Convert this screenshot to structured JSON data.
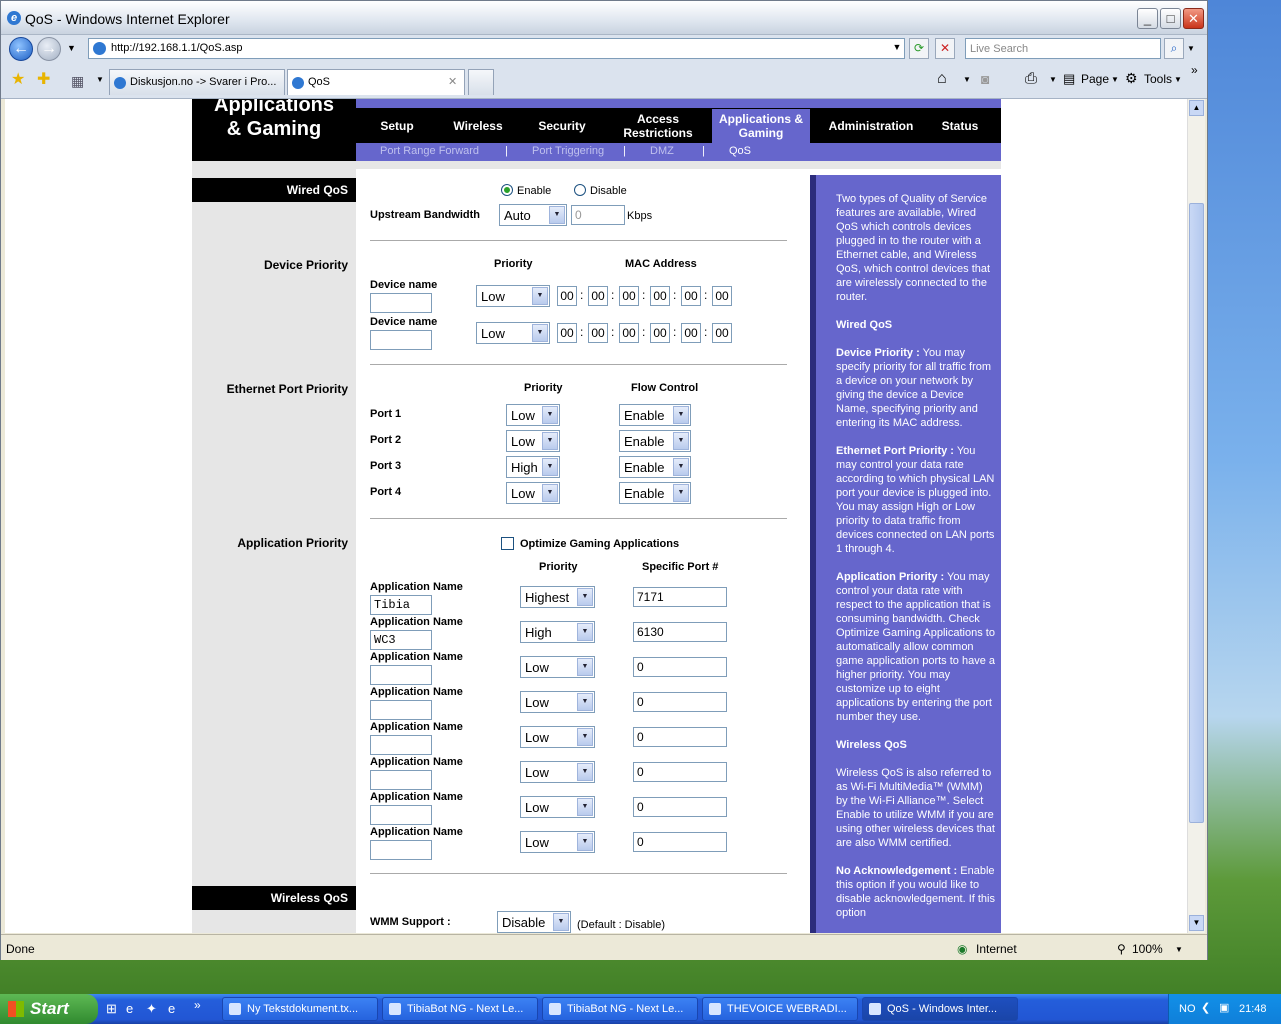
{
  "window": {
    "title": "QoS - Windows Internet Explorer"
  },
  "browser": {
    "address": "http://192.168.1.1/QoS.asp",
    "search_placeholder": "Live Search",
    "tabs": [
      {
        "label": "Diskusjon.no -> Svarer i Pro..."
      },
      {
        "label": "QoS"
      }
    ],
    "toolbar": {
      "page": "Page",
      "tools": "Tools"
    }
  },
  "status": {
    "text": "Done",
    "zone": "Internet",
    "zoom": "100%"
  },
  "router": {
    "header": "Applications & Gaming",
    "menu": [
      {
        "label": "Setup"
      },
      {
        "label": "Wireless"
      },
      {
        "label": "Security"
      },
      {
        "label": "Access Restrictions"
      },
      {
        "label": "Applications & Gaming"
      },
      {
        "label": "Administration"
      },
      {
        "label": "Status"
      }
    ],
    "submenu": [
      {
        "label": "Port Range Forward"
      },
      {
        "label": "Port Triggering"
      },
      {
        "label": "DMZ"
      },
      {
        "label": "QoS"
      }
    ],
    "sep": "|",
    "wired": {
      "section": "Wired QoS",
      "enable": "Enable",
      "disable": "Disable",
      "bandwidth_label": "Upstream Bandwidth",
      "bandwidth_value": "Auto",
      "bandwidth_num": "0",
      "unit": "Kbps"
    },
    "device": {
      "section": "Device Priority",
      "col_priority": "Priority",
      "col_mac": "MAC Address",
      "rows": [
        {
          "label": "Device name",
          "priority": "Low",
          "mac": [
            "00",
            "00",
            "00",
            "00",
            "00",
            "00"
          ]
        },
        {
          "label": "Device name",
          "priority": "Low",
          "mac": [
            "00",
            "00",
            "00",
            "00",
            "00",
            "00"
          ]
        }
      ],
      "colon": ":"
    },
    "ethernet": {
      "section": "Ethernet Port Priority",
      "col_priority": "Priority",
      "col_flow": "Flow Control",
      "rows": [
        {
          "port": "Port 1",
          "priority": "Low",
          "flow": "Enable"
        },
        {
          "port": "Port 2",
          "priority": "Low",
          "flow": "Enable"
        },
        {
          "port": "Port 3",
          "priority": "High",
          "flow": "Enable"
        },
        {
          "port": "Port 4",
          "priority": "Low",
          "flow": "Enable"
        }
      ]
    },
    "application": {
      "section": "Application Priority",
      "optimize": "Optimize Gaming Applications",
      "col_priority": "Priority",
      "col_port": "Specific Port #",
      "rows": [
        {
          "label": "Application Name",
          "name": "Tibia",
          "priority": "Highest",
          "port": "7171"
        },
        {
          "label": "Application Name",
          "name": "WC3",
          "priority": "High",
          "port": "6130"
        },
        {
          "label": "Application Name",
          "name": "",
          "priority": "Low",
          "port": "0"
        },
        {
          "label": "Application Name",
          "name": "",
          "priority": "Low",
          "port": "0"
        },
        {
          "label": "Application Name",
          "name": "",
          "priority": "Low",
          "port": "0"
        },
        {
          "label": "Application Name",
          "name": "",
          "priority": "Low",
          "port": "0"
        },
        {
          "label": "Application Name",
          "name": "",
          "priority": "Low",
          "port": "0"
        },
        {
          "label": "Application Name",
          "name": "",
          "priority": "Low",
          "port": "0"
        }
      ]
    },
    "wireless": {
      "section": "Wireless QoS",
      "wmm_label": "WMM Support :",
      "wmm_value": "Disable",
      "wmm_default": "(Default : Disable)"
    },
    "help": [
      {
        "text": "Two types of Quality of Service features are available, Wired QoS which controls devices plugged in to the router with a Ethernet cable, and Wireless QoS, which control devices that are wirelessly connected to the router."
      },
      {
        "bold": "Wired QoS"
      },
      {
        "bold": "Device Priority :",
        "text": " You may specify priority for all traffic from a device on your network by giving the device a Device Name, specifying priority and entering its MAC address."
      },
      {
        "bold": "Ethernet Port Priority :",
        "text": " You may control your data rate according to which physical LAN port your device is plugged into. You may assign High or Low priority to data traffic from devices connected on LAN ports 1 through 4."
      },
      {
        "bold": "Application Priority :",
        "text": " You may control your data rate with respect to the application that is consuming bandwidth. Check Optimize Gaming Applications to automatically allow common game application ports to have a higher priority. You may customize up to eight applications by entering the port number they use."
      },
      {
        "bold": "Wireless QoS"
      },
      {
        "text": "Wireless QoS is also referred to as Wi-Fi MultiMedia™ (WMM) by the Wi-Fi Alliance™. Select Enable to utilize WMM if you are using other wireless devices that are also WMM certified."
      },
      {
        "bold": "No Acknowledgement :",
        "text": " Enable this option if you would like to disable acknowledgement. If this option"
      }
    ]
  },
  "taskbar": {
    "start": "Start",
    "items": [
      {
        "label": "Ny Tekstdokument.tx..."
      },
      {
        "label": "TibiaBot NG - Next Le..."
      },
      {
        "label": "TibiaBot NG - Next Le..."
      },
      {
        "label": "THEVOICE WEBRADI..."
      },
      {
        "label": "QoS - Windows Inter..."
      }
    ],
    "lang": "NO",
    "time": "21:48"
  },
  "colors": {
    "router_purple": "#6666cc",
    "router_black": "#000000",
    "xp_blue": "#245edb"
  }
}
